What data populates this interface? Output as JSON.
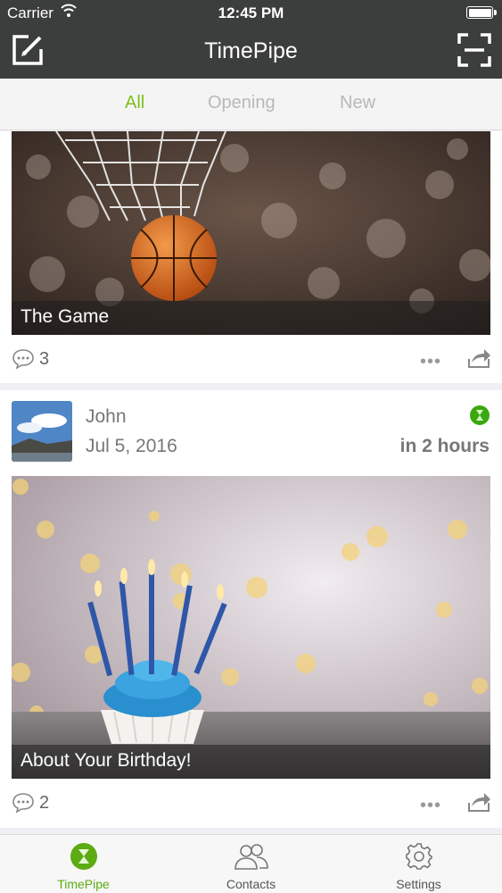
{
  "status_bar": {
    "carrier": "Carrier",
    "time": "12:45 PM"
  },
  "nav": {
    "title": "TimePipe",
    "left_icon": "compose-icon",
    "right_icon": "scan-icon"
  },
  "filters": {
    "items": [
      "All",
      "Opening",
      "New"
    ],
    "active": "All",
    "active_color": "#7dc11d"
  },
  "feed": {
    "posts": [
      {
        "caption": "The Game",
        "comments": "3"
      },
      {
        "author": "John",
        "date": "Jul 5, 2016",
        "countdown": "in 2 hours",
        "caption": "About Your Birthday!",
        "comments": "2",
        "status_color": "#3aa80f"
      }
    ]
  },
  "tabbar": {
    "items": [
      {
        "label": "TimePipe",
        "icon": "timepipe-icon"
      },
      {
        "label": "Contacts",
        "icon": "contacts-icon"
      },
      {
        "label": "Settings",
        "icon": "settings-icon"
      }
    ],
    "active_color": "#5cab12"
  }
}
